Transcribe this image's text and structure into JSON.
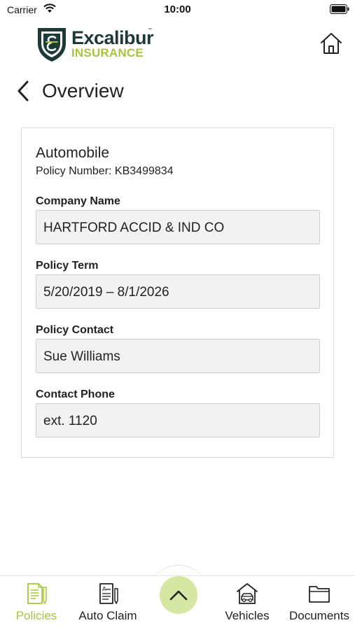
{
  "status_bar": {
    "carrier": "Carrier",
    "time": "10:00"
  },
  "header": {
    "logo_line1": "Excalibur",
    "logo_tm": "™",
    "logo_line2": "INSURANCE",
    "icons": {
      "logo": "shield-e-logo",
      "home": "home-icon"
    }
  },
  "nav": {
    "title": "Overview",
    "back_icon": "chevron-left-icon"
  },
  "policy": {
    "type": "Automobile",
    "number_text": "Policy Number: KB3499834",
    "fields": [
      {
        "label": "Company Name",
        "value": "HARTFORD ACCID & IND CO"
      },
      {
        "label": "Policy Term",
        "value": "5/20/2019 – 8/1/2026"
      },
      {
        "label": "Policy Contact",
        "value": "Sue Williams"
      },
      {
        "label": "Contact Phone",
        "value": "ext. 1120"
      }
    ]
  },
  "tabbar": {
    "tabs": [
      {
        "label": "Policies",
        "icon": "policy-document-icon",
        "active": true
      },
      {
        "label": "Auto Claim",
        "icon": "claim-form-icon",
        "active": false
      },
      {
        "label": "Vehicles",
        "icon": "garage-car-icon",
        "active": false
      },
      {
        "label": "Documents",
        "icon": "folder-icon",
        "active": false
      }
    ],
    "center_button_icon": "chevron-up-icon"
  },
  "colors": {
    "accent_green": "#a5c63b",
    "brand_dark": "#1d3a37",
    "fab_bg": "#d5e7a0",
    "field_bg": "#f2f2f2"
  }
}
